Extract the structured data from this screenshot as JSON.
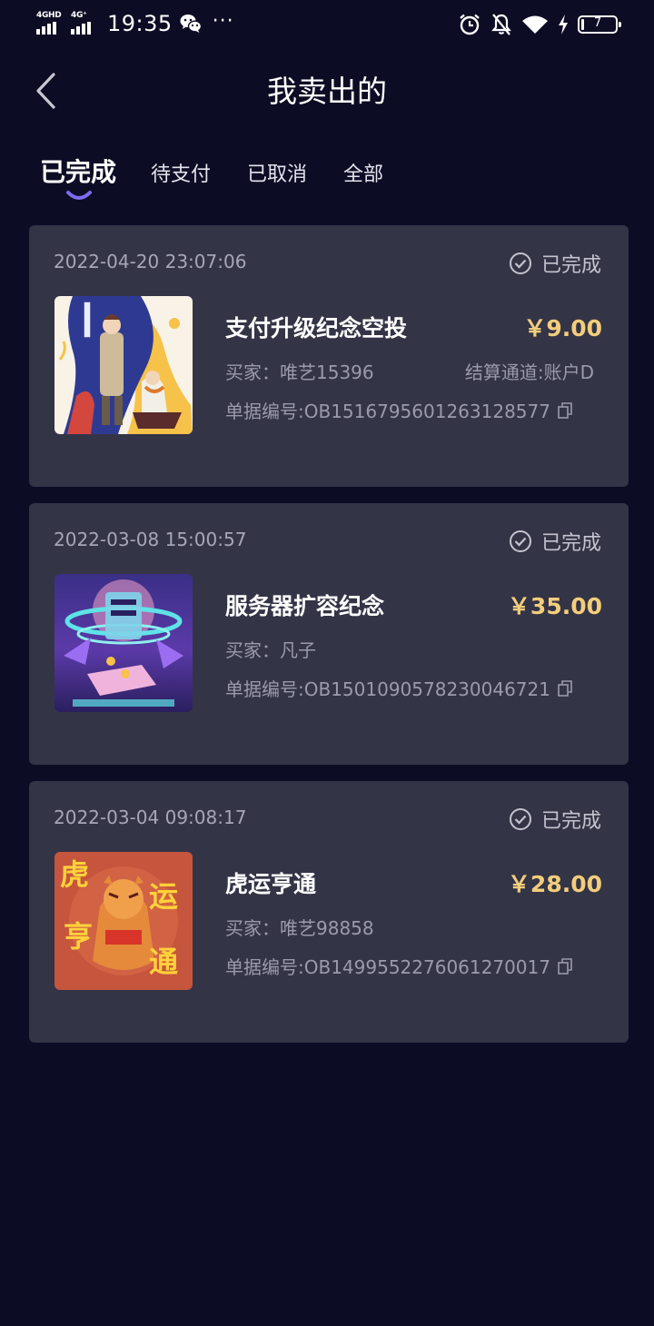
{
  "status_bar": {
    "network_1": "4GHD",
    "network_2": "4G⁺",
    "time": "19:35",
    "more": "···",
    "battery_level": "7"
  },
  "header": {
    "title": "我卖出的"
  },
  "tabs": [
    {
      "label": "已完成",
      "active": true
    },
    {
      "label": "待支付",
      "active": false
    },
    {
      "label": "已取消",
      "active": false
    },
    {
      "label": "全部",
      "active": false
    }
  ],
  "orders": [
    {
      "date": "2022-04-20 23:07:06",
      "status": "已完成",
      "name": "支付升级纪念空投",
      "price": "￥9.00",
      "buyer": "买家：唯艺15396",
      "channel": "结算通道:账户D",
      "order_no": "单据编号:OB1516795601263128577"
    },
    {
      "date": "2022-03-08 15:00:57",
      "status": "已完成",
      "name": "服务器扩容纪念",
      "price": "￥35.00",
      "buyer": "买家：凡子",
      "order_no": "单据编号:OB1501090578230046721"
    },
    {
      "date": "2022-03-04 09:08:17",
      "status": "已完成",
      "name": "虎运亨通",
      "price": "￥28.00",
      "buyer": "买家：唯艺98858",
      "order_no": "单据编号:OB1499552276061270017",
      "artwork_text": [
        "虎",
        "运",
        "亨",
        "通"
      ]
    }
  ],
  "colors": {
    "background": "#0c0c24",
    "card": "#343447",
    "price": "#f3cd7c",
    "accent": "#7c6cf0"
  }
}
